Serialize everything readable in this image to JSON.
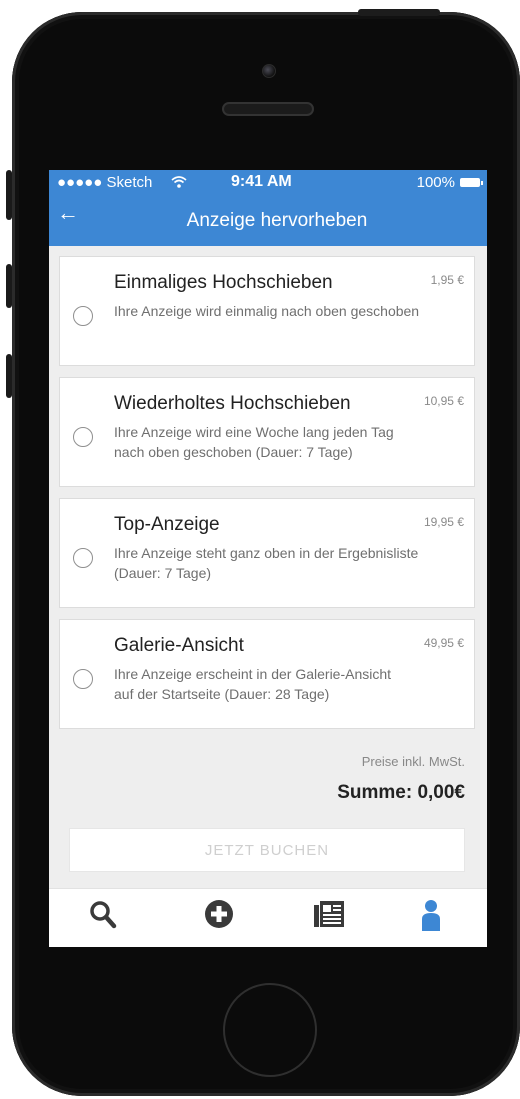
{
  "status_bar": {
    "carrier": "●●●●● Sketch",
    "wifi": "wifi-icon",
    "time": "9:41 AM",
    "battery": "100%"
  },
  "nav": {
    "title": "Anzeige hervorheben",
    "back": "←"
  },
  "options": [
    {
      "title": "Einmaliges Hochschieben",
      "price": "1,95 €",
      "description": "Ihre Anzeige wird einmalig nach oben geschoben"
    },
    {
      "title": "Wiederholtes Hochschieben",
      "price": "10,95 €",
      "description": "Ihre Anzeige wird eine Woche lang jeden Tag nach oben geschoben (Dauer: 7 Tage)"
    },
    {
      "title": "Top-Anzeige",
      "price": "19,95 €",
      "description": "Ihre Anzeige steht ganz oben in der Ergebnisliste (Dauer: 7 Tage)"
    },
    {
      "title": "Galerie-Ansicht",
      "price": "49,95 €",
      "description": "Ihre Anzeige erscheint in der Galerie-Ansicht auf der Startseite (Dauer: 28 Tage)"
    }
  ],
  "summary": {
    "note": "Preise inkl. MwSt.",
    "total": "Summe: 0,00€"
  },
  "buy_button": "JETZT BUCHEN",
  "tabbar": {
    "items": [
      "search-icon",
      "add-icon",
      "news-icon",
      "profile-icon"
    ],
    "active": "profile-icon"
  },
  "colors": {
    "primary": "#3d87d4",
    "background": "#eeeeee",
    "icon": "#3a3a3a"
  }
}
